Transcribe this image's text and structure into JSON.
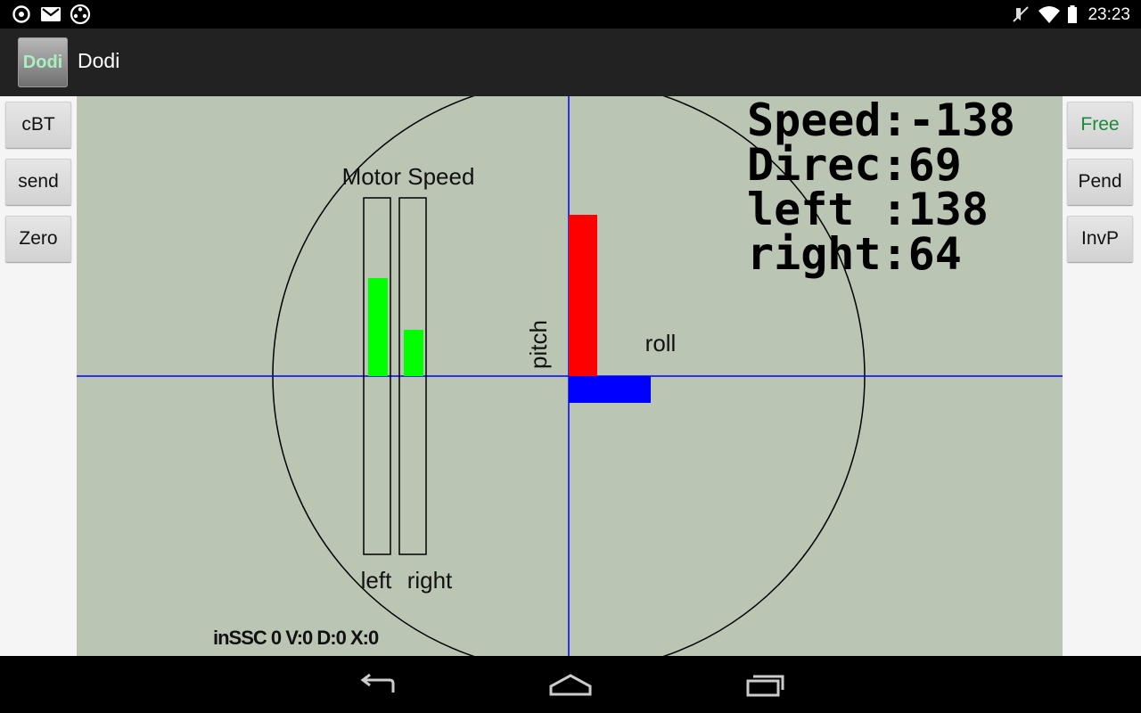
{
  "status_bar": {
    "left_icons": [
      "sync-icon",
      "gmail-icon",
      "media-icon"
    ],
    "right_icons": [
      "mute-icon",
      "wifi-icon",
      "battery-icon"
    ],
    "time": "23:23"
  },
  "action_bar": {
    "app_icon_text": "Dodi",
    "title": "Dodi"
  },
  "left_buttons": [
    "cBT",
    "send",
    "Zero"
  ],
  "right_buttons": [
    "Free",
    "Pend",
    "InvP"
  ],
  "colors": {
    "canvas_bg": "#bac5b4",
    "pitch_bar": "#ff0000",
    "roll_bar": "#0000ff",
    "motor_bars": "#00ff00",
    "axis_lines": "#0000ff",
    "free_button_text": "#1a8a3a"
  },
  "readout": {
    "speed": "Speed:-138",
    "direc": "Direc:69",
    "left": "left :138",
    "right": "right:64"
  },
  "labels": {
    "motor_speed": "Motor Speed",
    "left": "left",
    "right": "right",
    "pitch": "pitch",
    "roll": "roll",
    "status_line": "inSSC 0 V:0 D:0 X:0"
  },
  "motor_levels": {
    "left": 0.55,
    "right": 0.26
  },
  "nav_bar": [
    "back-icon",
    "home-icon",
    "recents-icon"
  ]
}
